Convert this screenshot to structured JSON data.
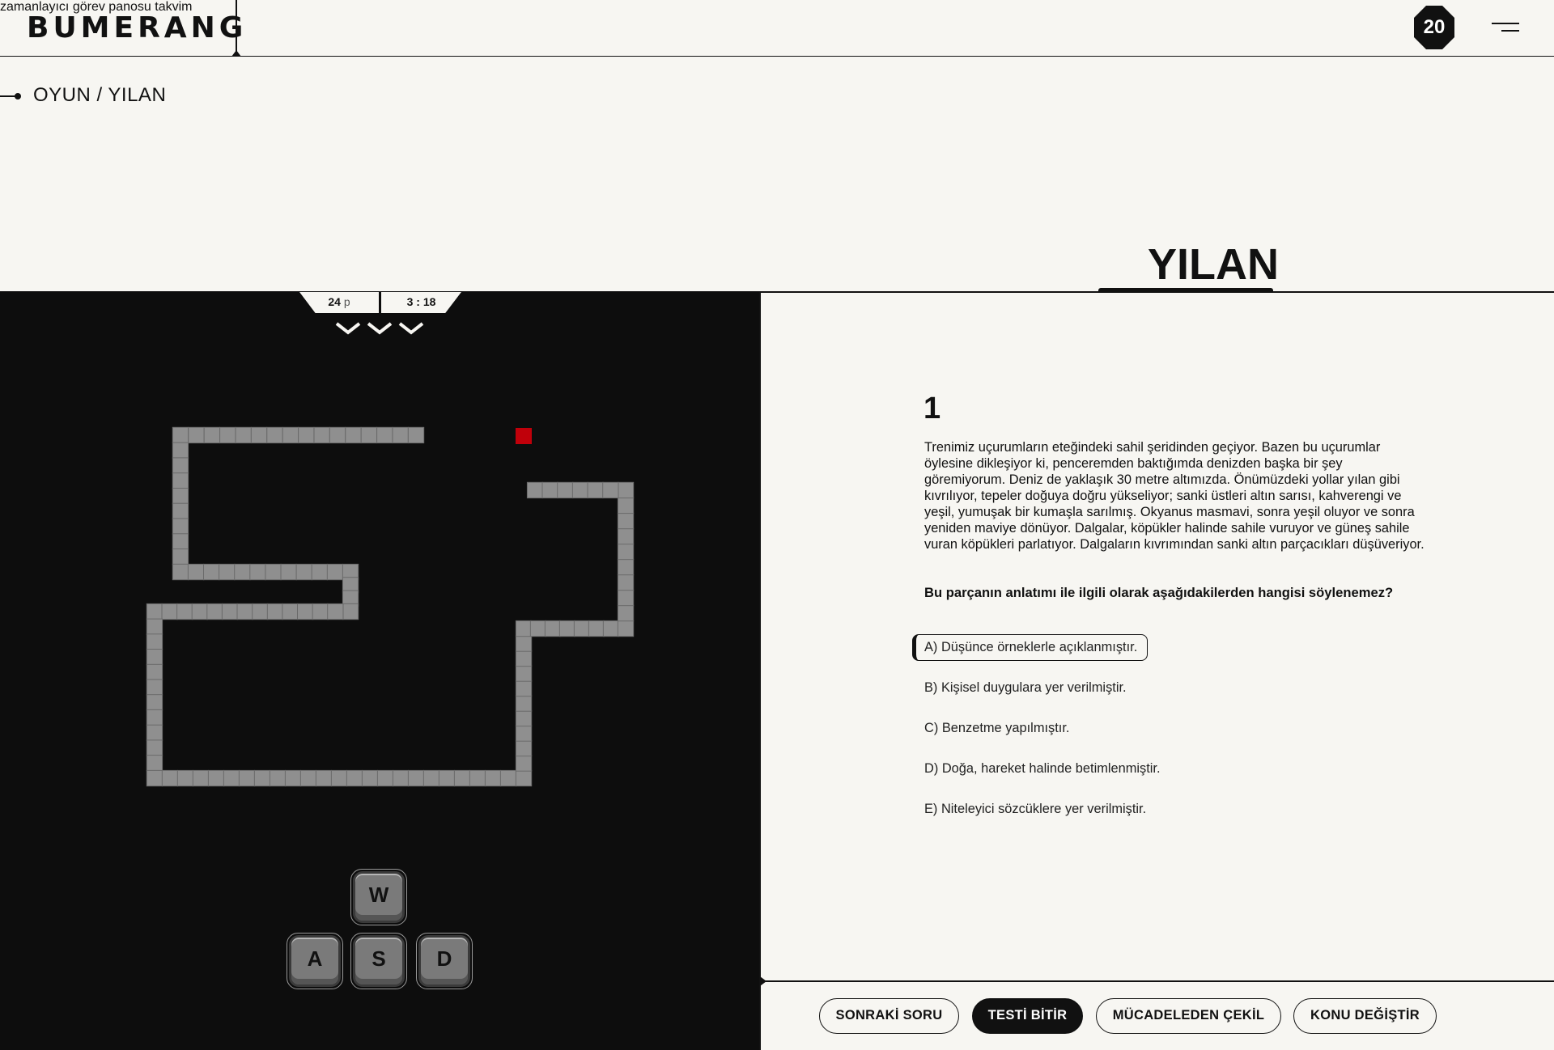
{
  "header": {
    "logo": "BUMERANG",
    "nav": [
      {
        "label": "zamanlayıcı"
      },
      {
        "label": "görev panosu"
      },
      {
        "label": "takvim"
      }
    ],
    "badge": "20",
    "menu_icon": "hamburger-menu-icon"
  },
  "breadcrumb": "OYUN / YILAN",
  "page_title": "YILAN",
  "game": {
    "score": "24",
    "score_unit": "p",
    "timer": "3 : 18",
    "lives_icons": [
      "chevron-down-icon",
      "chevron-down-icon",
      "chevron-down-icon"
    ],
    "colors": {
      "background": "#0d0d0d",
      "snake": "#8f8f8f",
      "food": "#c0000a"
    },
    "keys": {
      "up": "W",
      "left": "A",
      "down": "S",
      "right": "D"
    }
  },
  "question": {
    "number": "1",
    "passage": "Trenimiz uçurumların eteğindeki sahil şeridinden geçiyor. Bazen bu uçurumlar öylesine dikleşiyor ki, penceremden baktığımda denizden başka bir şey göremiyorum. Deniz de yaklaşık 30 metre altımızda. Önümüzdeki yollar yılan gibi kıvrılıyor, tepeler doğuya doğru yükseliyor; sanki üstleri altın sarısı, kahverengi ve yeşil, yumuşak bir kumaşla sarılmış. Okyanus masmavi, sonra yeşil oluyor ve sonra yeniden maviye dönüyor. Dalgalar, köpükler halinde sahile vuruyor ve güneş sahile vuran köpükleri parlatıyor. Dalgaların kıvrımından sanki altın parçacıkları düşüveriyor.",
    "stem": "Bu parçanın anlatımı ile ilgili olarak aşağıdakilerden hangisi söylenemez?",
    "options": [
      {
        "label": "A) Düşünce örneklerle açıklanmıştır.",
        "selected": true
      },
      {
        "label": "B) Kişisel duygulara yer verilmiştir.",
        "selected": false
      },
      {
        "label": "C) Benzetme yapılmıştır.",
        "selected": false
      },
      {
        "label": "D) Doğa, hareket halinde betimlenmiştir.",
        "selected": false
      },
      {
        "label": "E) Niteleyici sözcüklere yer verilmiştir.",
        "selected": false
      }
    ]
  },
  "actions": {
    "next": "SONRAKİ SORU",
    "finish": "TESTİ BİTİR",
    "withdraw": "MÜCADELEDEN ÇEKİL",
    "change_topic": "KONU DEĞİŞTİR"
  }
}
